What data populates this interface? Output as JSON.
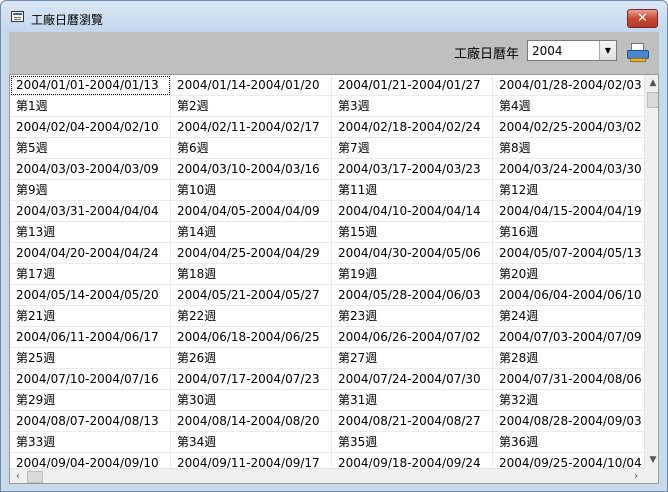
{
  "window": {
    "title": "工廠日曆瀏覽",
    "close_glyph": "✕"
  },
  "toolbar": {
    "year_label": "工廠日曆年",
    "year_value": "2004",
    "dropdown_glyph": "▼"
  },
  "calendar": {
    "columns": 4,
    "rows": [
      [
        "2004/01/01-2004/01/13",
        "2004/01/14-2004/01/20",
        "2004/01/21-2004/01/27",
        "2004/01/28-2004/02/03"
      ],
      [
        "第1週",
        "第2週",
        "第3週",
        "第4週"
      ],
      [
        "2004/02/04-2004/02/10",
        "2004/02/11-2004/02/17",
        "2004/02/18-2004/02/24",
        "2004/02/25-2004/03/02"
      ],
      [
        "第5週",
        "第6週",
        "第7週",
        "第8週"
      ],
      [
        "2004/03/03-2004/03/09",
        "2004/03/10-2004/03/16",
        "2004/03/17-2004/03/23",
        "2004/03/24-2004/03/30"
      ],
      [
        "第9週",
        "第10週",
        "第11週",
        "第12週"
      ],
      [
        "2004/03/31-2004/04/04",
        "2004/04/05-2004/04/09",
        "2004/04/10-2004/04/14",
        "2004/04/15-2004/04/19"
      ],
      [
        "第13週",
        "第14週",
        "第15週",
        "第16週"
      ],
      [
        "2004/04/20-2004/04/24",
        "2004/04/25-2004/04/29",
        "2004/04/30-2004/05/06",
        "2004/05/07-2004/05/13"
      ],
      [
        "第17週",
        "第18週",
        "第19週",
        "第20週"
      ],
      [
        "2004/05/14-2004/05/20",
        "2004/05/21-2004/05/27",
        "2004/05/28-2004/06/03",
        "2004/06/04-2004/06/10"
      ],
      [
        "第21週",
        "第22週",
        "第23週",
        "第24週"
      ],
      [
        "2004/06/11-2004/06/17",
        "2004/06/18-2004/06/25",
        "2004/06/26-2004/07/02",
        "2004/07/03-2004/07/09"
      ],
      [
        "第25週",
        "第26週",
        "第27週",
        "第28週"
      ],
      [
        "2004/07/10-2004/07/16",
        "2004/07/17-2004/07/23",
        "2004/07/24-2004/07/30",
        "2004/07/31-2004/08/06"
      ],
      [
        "第29週",
        "第30週",
        "第31週",
        "第32週"
      ],
      [
        "2004/08/07-2004/08/13",
        "2004/08/14-2004/08/20",
        "2004/08/21-2004/08/27",
        "2004/08/28-2004/09/03"
      ],
      [
        "第33週",
        "第34週",
        "第35週",
        "第36週"
      ],
      [
        "2004/09/04-2004/09/10",
        "2004/09/11-2004/09/17",
        "2004/09/18-2004/09/24",
        "2004/09/25-2004/10/04"
      ]
    ]
  },
  "scrollbars": {
    "up": "▲",
    "down": "▼",
    "left": "‹",
    "right": "›"
  },
  "colors": {
    "toolbar_bg": "#bfbfbf",
    "close_button": "#c74a36",
    "print_icon": "#4a86c8"
  }
}
